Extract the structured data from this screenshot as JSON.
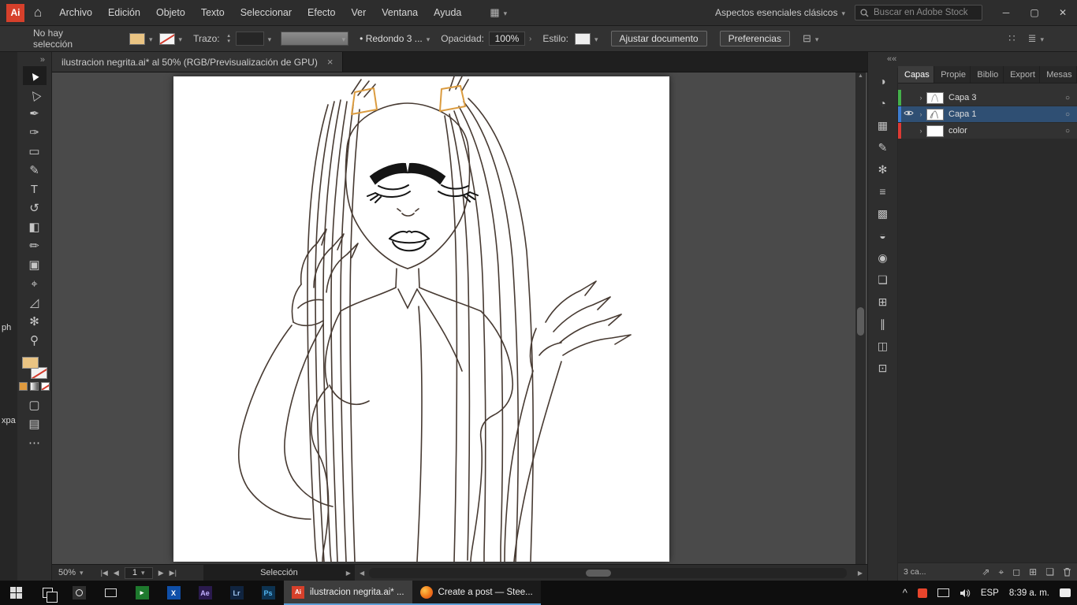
{
  "colors": {
    "fill_swatch": "#eac483",
    "selected_layer_bg": "#2f4f73",
    "layer_colors": [
      "#44b04a",
      "#3d7dd1",
      "#dd3a34"
    ],
    "artwork_line": "#473a32",
    "artwork_accent": "#db9c40"
  },
  "titlebar": {
    "app_badge": "Ai",
    "home_icon": "⌂",
    "menus": [
      "Archivo",
      "Edición",
      "Objeto",
      "Texto",
      "Seleccionar",
      "Efecto",
      "Ver",
      "Ventana",
      "Ayuda"
    ],
    "arrange_icon": "▦",
    "workspace_switcher": "Aspectos esenciales clásicos",
    "search_placeholder": "Buscar en Adobe Stock",
    "minimize": "─",
    "maximize": "▢",
    "close": "✕"
  },
  "controlbar": {
    "selection_status": "No hay selección",
    "stroke_label": "Trazo:",
    "brush_value": "• Redondo 3 ...",
    "opacity_label": "Opacidad:",
    "opacity_value": "100%",
    "style_label": "Estilo:",
    "fit_document_button": "Ajustar documento",
    "preferences_button": "Preferencias",
    "align_icon": "⊟",
    "grid_icon": "∷",
    "list_icon": "≣"
  },
  "document": {
    "tab_title": "ilustracion negrita.ai* al 50% (RGB/Previsualización de GPU)",
    "close": "×"
  },
  "toolbar": {
    "expand": "»",
    "more": "⋯",
    "draw_mode": "▢",
    "screen_mode": "▤",
    "tools": [
      {
        "name": "selection-tool",
        "glyph": "▲"
      },
      {
        "name": "direct-selection-tool",
        "glyph": "△"
      },
      {
        "name": "pen-tool",
        "glyph": "✒"
      },
      {
        "name": "curvature-tool",
        "glyph": "✑"
      },
      {
        "name": "rectangle-tool",
        "glyph": "▭"
      },
      {
        "name": "paintbrush-tool",
        "glyph": "✎"
      },
      {
        "name": "type-tool",
        "glyph": "T"
      },
      {
        "name": "rotate-tool",
        "glyph": "↺"
      },
      {
        "name": "eraser-tool",
        "glyph": "◧"
      },
      {
        "name": "pencil-tool",
        "glyph": "✏"
      },
      {
        "name": "artboard-tool",
        "glyph": "▣"
      },
      {
        "name": "eyedropper-tool",
        "glyph": "⌖"
      },
      {
        "name": "shear-tool",
        "glyph": "◿"
      },
      {
        "name": "symbol-sprayer-tool",
        "glyph": "✻"
      },
      {
        "name": "zoom-tool",
        "glyph": "⚲"
      }
    ]
  },
  "edge_labels": [
    "ph",
    "xpa"
  ],
  "statusbar": {
    "zoom": "50%",
    "nav_first": "|◀",
    "nav_prev": "◀",
    "artboard": "1",
    "nav_next": "▶",
    "nav_last": "▶|",
    "status": "Selección",
    "status_arrow": "▶"
  },
  "dock": {
    "collapse": "««",
    "icons": [
      {
        "name": "color-icon",
        "glyph": "◑"
      },
      {
        "name": "color-guide-icon",
        "glyph": "◔"
      },
      {
        "name": "swatches-icon",
        "glyph": "▦"
      },
      {
        "name": "brushes-icon",
        "glyph": "✎"
      },
      {
        "name": "symbols-icon",
        "glyph": "✻"
      },
      {
        "name": "stroke-icon",
        "glyph": "≡"
      },
      {
        "name": "gradient-icon",
        "glyph": "▩"
      },
      {
        "name": "transparency-icon",
        "glyph": "◒"
      },
      {
        "name": "appearance-icon",
        "glyph": "◉"
      },
      {
        "name": "graphic-styles-icon",
        "glyph": "❏"
      },
      {
        "name": "artboards-icon",
        "glyph": "⊞"
      },
      {
        "name": "align-icon",
        "glyph": "∥"
      },
      {
        "name": "pathfinder-icon",
        "glyph": "◫"
      },
      {
        "name": "transform-icon",
        "glyph": "⊡"
      }
    ],
    "tabs": [
      "Capas",
      "Propie",
      "Biblio",
      "Export",
      "Mesas"
    ],
    "layers": [
      {
        "name": "Capa 3"
      },
      {
        "name": "Capa 1"
      },
      {
        "name": "color"
      }
    ],
    "target": "○",
    "chevron": "›",
    "footer_count": "3 ca...",
    "footer_icons": [
      {
        "name": "collect-export-icon",
        "glyph": "⇗"
      },
      {
        "name": "locate-object-icon",
        "glyph": "⌖"
      },
      {
        "name": "make-mask-icon",
        "glyph": "◻"
      },
      {
        "name": "new-sublayer-icon",
        "glyph": "⊞"
      },
      {
        "name": "new-layer-icon",
        "glyph": "❏"
      }
    ]
  },
  "taskbar": {
    "x_label": "X",
    "ae_label": "Ae",
    "lr_label": "Lr",
    "ps_label": "Ps",
    "ai_badge": "Ai",
    "ai_window_label": "ilustracion negrita.ai* ...",
    "firefox_window_label": "Create a post — Stee...",
    "tray_expand": "^",
    "tray_language": "ESP",
    "tray_time": "8:39 a. m."
  }
}
